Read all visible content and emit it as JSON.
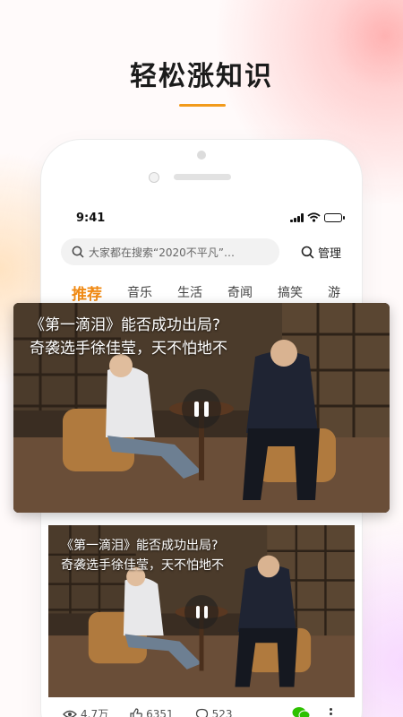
{
  "headline": "轻松涨知识",
  "colors": {
    "accent": "#f08a14",
    "active_tab": "#f08a14"
  },
  "status_bar": {
    "time": "9:41",
    "icons": [
      "cellular-signal-icon",
      "wifi-icon",
      "battery-icon"
    ]
  },
  "search": {
    "placeholder": "大家都在搜索“2020不平凡”…",
    "icon": "search-icon"
  },
  "manage": {
    "label": "管理",
    "icon": "search-icon"
  },
  "tabs": [
    {
      "label": "推荐",
      "active": true
    },
    {
      "label": "音乐",
      "active": false
    },
    {
      "label": "生活",
      "active": false
    },
    {
      "label": "奇闻",
      "active": false
    },
    {
      "label": "搞笑",
      "active": false
    },
    {
      "label": "游",
      "active": false
    }
  ],
  "featured_video": {
    "caption_line1": "《第一滴泪》能否成功出局?",
    "caption_line2": "奇袭选手徐佳莹，天不怕地不",
    "state": "playing",
    "control_icon": "pause-icon"
  },
  "feed_video": {
    "caption_line1": "《第一滴泪》能否成功出局?",
    "caption_line2": "奇袭选手徐佳莹，天不怕地不",
    "control_icon": "pause-icon"
  },
  "feed_stats": {
    "views": "4.7万",
    "likes": "6351",
    "comments": "523"
  }
}
